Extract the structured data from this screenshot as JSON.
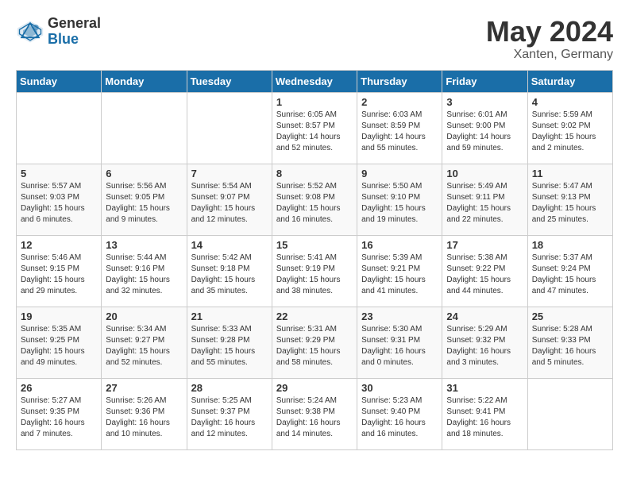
{
  "logo": {
    "general": "General",
    "blue": "Blue"
  },
  "title": "May 2024",
  "location": "Xanten, Germany",
  "days_of_week": [
    "Sunday",
    "Monday",
    "Tuesday",
    "Wednesday",
    "Thursday",
    "Friday",
    "Saturday"
  ],
  "weeks": [
    [
      {
        "day": "",
        "info": ""
      },
      {
        "day": "",
        "info": ""
      },
      {
        "day": "",
        "info": ""
      },
      {
        "day": "1",
        "info": "Sunrise: 6:05 AM\nSunset: 8:57 PM\nDaylight: 14 hours\nand 52 minutes."
      },
      {
        "day": "2",
        "info": "Sunrise: 6:03 AM\nSunset: 8:59 PM\nDaylight: 14 hours\nand 55 minutes."
      },
      {
        "day": "3",
        "info": "Sunrise: 6:01 AM\nSunset: 9:00 PM\nDaylight: 14 hours\nand 59 minutes."
      },
      {
        "day": "4",
        "info": "Sunrise: 5:59 AM\nSunset: 9:02 PM\nDaylight: 15 hours\nand 2 minutes."
      }
    ],
    [
      {
        "day": "5",
        "info": "Sunrise: 5:57 AM\nSunset: 9:03 PM\nDaylight: 15 hours\nand 6 minutes."
      },
      {
        "day": "6",
        "info": "Sunrise: 5:56 AM\nSunset: 9:05 PM\nDaylight: 15 hours\nand 9 minutes."
      },
      {
        "day": "7",
        "info": "Sunrise: 5:54 AM\nSunset: 9:07 PM\nDaylight: 15 hours\nand 12 minutes."
      },
      {
        "day": "8",
        "info": "Sunrise: 5:52 AM\nSunset: 9:08 PM\nDaylight: 15 hours\nand 16 minutes."
      },
      {
        "day": "9",
        "info": "Sunrise: 5:50 AM\nSunset: 9:10 PM\nDaylight: 15 hours\nand 19 minutes."
      },
      {
        "day": "10",
        "info": "Sunrise: 5:49 AM\nSunset: 9:11 PM\nDaylight: 15 hours\nand 22 minutes."
      },
      {
        "day": "11",
        "info": "Sunrise: 5:47 AM\nSunset: 9:13 PM\nDaylight: 15 hours\nand 25 minutes."
      }
    ],
    [
      {
        "day": "12",
        "info": "Sunrise: 5:46 AM\nSunset: 9:15 PM\nDaylight: 15 hours\nand 29 minutes."
      },
      {
        "day": "13",
        "info": "Sunrise: 5:44 AM\nSunset: 9:16 PM\nDaylight: 15 hours\nand 32 minutes."
      },
      {
        "day": "14",
        "info": "Sunrise: 5:42 AM\nSunset: 9:18 PM\nDaylight: 15 hours\nand 35 minutes."
      },
      {
        "day": "15",
        "info": "Sunrise: 5:41 AM\nSunset: 9:19 PM\nDaylight: 15 hours\nand 38 minutes."
      },
      {
        "day": "16",
        "info": "Sunrise: 5:39 AM\nSunset: 9:21 PM\nDaylight: 15 hours\nand 41 minutes."
      },
      {
        "day": "17",
        "info": "Sunrise: 5:38 AM\nSunset: 9:22 PM\nDaylight: 15 hours\nand 44 minutes."
      },
      {
        "day": "18",
        "info": "Sunrise: 5:37 AM\nSunset: 9:24 PM\nDaylight: 15 hours\nand 47 minutes."
      }
    ],
    [
      {
        "day": "19",
        "info": "Sunrise: 5:35 AM\nSunset: 9:25 PM\nDaylight: 15 hours\nand 49 minutes."
      },
      {
        "day": "20",
        "info": "Sunrise: 5:34 AM\nSunset: 9:27 PM\nDaylight: 15 hours\nand 52 minutes."
      },
      {
        "day": "21",
        "info": "Sunrise: 5:33 AM\nSunset: 9:28 PM\nDaylight: 15 hours\nand 55 minutes."
      },
      {
        "day": "22",
        "info": "Sunrise: 5:31 AM\nSunset: 9:29 PM\nDaylight: 15 hours\nand 58 minutes."
      },
      {
        "day": "23",
        "info": "Sunrise: 5:30 AM\nSunset: 9:31 PM\nDaylight: 16 hours\nand 0 minutes."
      },
      {
        "day": "24",
        "info": "Sunrise: 5:29 AM\nSunset: 9:32 PM\nDaylight: 16 hours\nand 3 minutes."
      },
      {
        "day": "25",
        "info": "Sunrise: 5:28 AM\nSunset: 9:33 PM\nDaylight: 16 hours\nand 5 minutes."
      }
    ],
    [
      {
        "day": "26",
        "info": "Sunrise: 5:27 AM\nSunset: 9:35 PM\nDaylight: 16 hours\nand 7 minutes."
      },
      {
        "day": "27",
        "info": "Sunrise: 5:26 AM\nSunset: 9:36 PM\nDaylight: 16 hours\nand 10 minutes."
      },
      {
        "day": "28",
        "info": "Sunrise: 5:25 AM\nSunset: 9:37 PM\nDaylight: 16 hours\nand 12 minutes."
      },
      {
        "day": "29",
        "info": "Sunrise: 5:24 AM\nSunset: 9:38 PM\nDaylight: 16 hours\nand 14 minutes."
      },
      {
        "day": "30",
        "info": "Sunrise: 5:23 AM\nSunset: 9:40 PM\nDaylight: 16 hours\nand 16 minutes."
      },
      {
        "day": "31",
        "info": "Sunrise: 5:22 AM\nSunset: 9:41 PM\nDaylight: 16 hours\nand 18 minutes."
      },
      {
        "day": "",
        "info": ""
      }
    ]
  ]
}
